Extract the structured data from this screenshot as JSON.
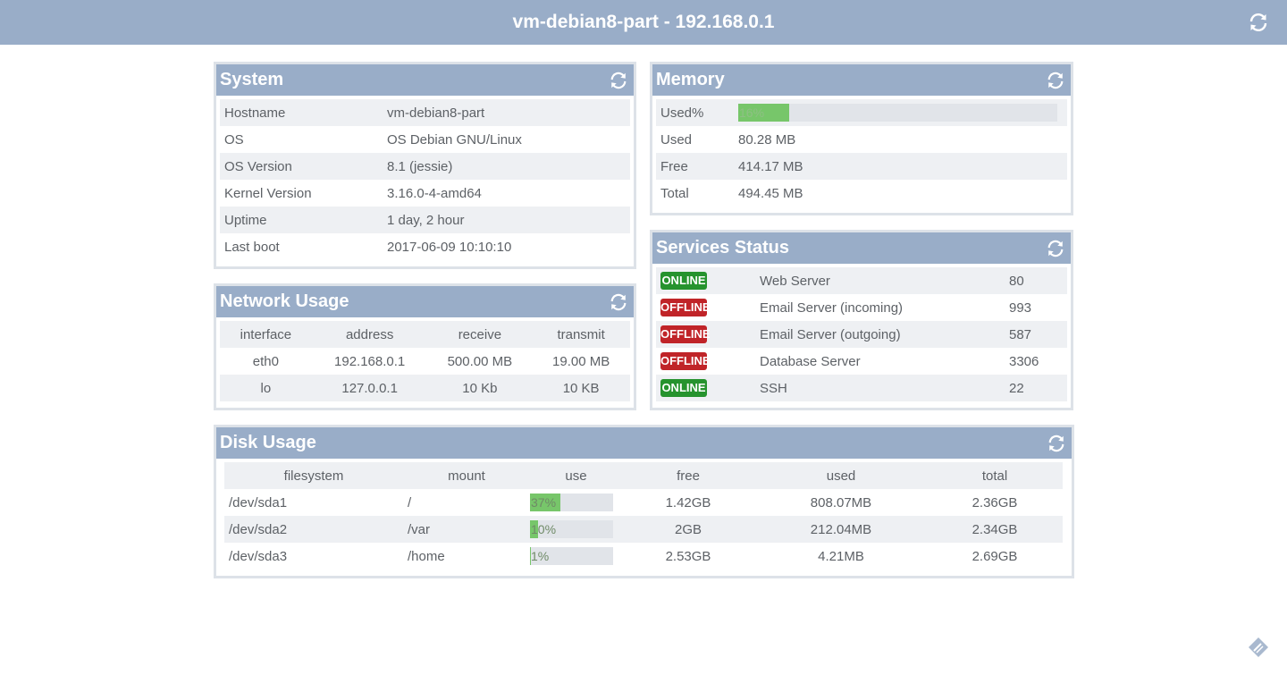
{
  "header": {
    "title": "vm-debian8-part - 192.168.0.1"
  },
  "system": {
    "title": "System",
    "rows": [
      {
        "key": "Hostname",
        "value": "vm-debian8-part"
      },
      {
        "key": "OS",
        "value": "OS Debian GNU/Linux"
      },
      {
        "key": "OS Version",
        "value": "8.1 (jessie)"
      },
      {
        "key": "Kernel Version",
        "value": "3.16.0-4-amd64"
      },
      {
        "key": "Uptime",
        "value": "1 day, 2 hour"
      },
      {
        "key": "Last boot",
        "value": "2017-06-09 10:10:10"
      }
    ]
  },
  "memory": {
    "title": "Memory",
    "used_pct_label": "Used%",
    "used_pct_text": "16%",
    "used_pct": 16,
    "rows": [
      {
        "key": "Used",
        "value": "80.28 MB"
      },
      {
        "key": "Free",
        "value": "414.17 MB"
      },
      {
        "key": "Total",
        "value": "494.45 MB"
      }
    ]
  },
  "network": {
    "title": "Network Usage",
    "headers": [
      "interface",
      "address",
      "receive",
      "transmit"
    ],
    "rows": [
      [
        "eth0",
        "192.168.0.1",
        "500.00 MB",
        "19.00 MB"
      ],
      [
        "lo",
        "127.0.0.1",
        "10 Kb",
        "10 KB"
      ]
    ]
  },
  "services": {
    "title": "Services Status",
    "rows": [
      {
        "status": "ONLINE",
        "name": "Web Server",
        "port": "80"
      },
      {
        "status": "OFFLINE",
        "name": "Email Server (incoming)",
        "port": "993"
      },
      {
        "status": "OFFLINE",
        "name": "Email Server (outgoing)",
        "port": "587"
      },
      {
        "status": "OFFLINE",
        "name": "Database Server",
        "port": "3306"
      },
      {
        "status": "ONLINE",
        "name": "SSH",
        "port": "22"
      }
    ]
  },
  "disk": {
    "title": "Disk Usage",
    "headers": [
      "filesystem",
      "mount",
      "use",
      "free",
      "used",
      "total"
    ],
    "rows": [
      {
        "filesystem": "/dev/sda1",
        "mount": "/",
        "use_text": "37%",
        "use_pct": 37,
        "free": "1.42GB",
        "used": "808.07MB",
        "total": "2.36GB"
      },
      {
        "filesystem": "/dev/sda2",
        "mount": "/var",
        "use_text": "10%",
        "use_pct": 10,
        "free": "2GB",
        "used": "212.04MB",
        "total": "2.34GB"
      },
      {
        "filesystem": "/dev/sda3",
        "mount": "/home",
        "use_text": "1%",
        "use_pct": 1,
        "free": "2.53GB",
        "used": "4.21MB",
        "total": "2.69GB"
      }
    ]
  },
  "colors": {
    "accent": "#99adc8",
    "online": "#26932e",
    "offline": "#c02428",
    "bar_fill": "#77c66a"
  },
  "icons": {
    "refresh": "refresh-icon",
    "corner": "edit-icon"
  }
}
